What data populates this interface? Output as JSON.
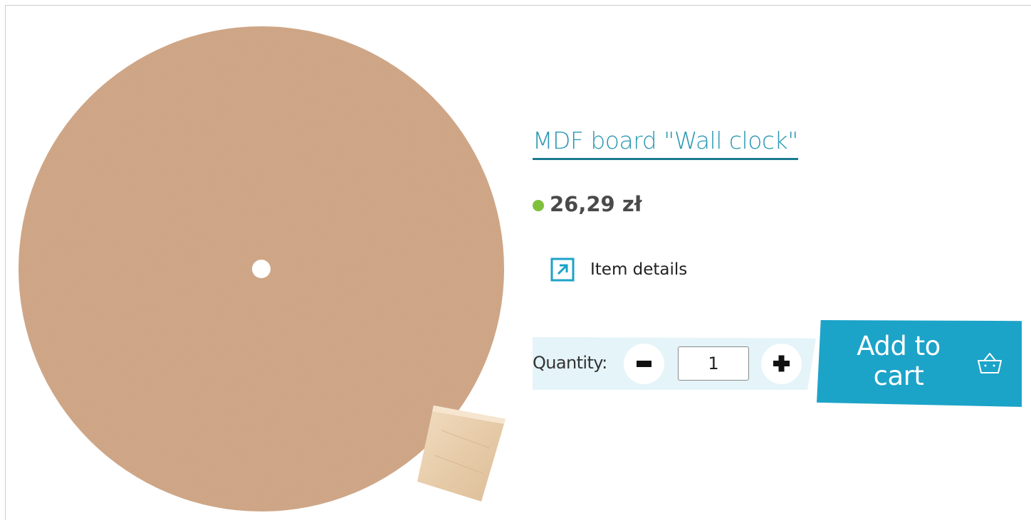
{
  "product": {
    "title": "MDF board \"Wall clock\"",
    "price": "26,29 zł",
    "details_label": "Item details",
    "quantity_label": "Quantity:",
    "quantity_value": "1",
    "add_to_cart_label": "Add to cart",
    "image_icon": "clock-board-photo"
  },
  "icons": {
    "stock": "stock-dot-icon",
    "details": "external-arrow-icon",
    "minus": "minus-icon",
    "plus": "plus-icon",
    "basket": "basket-icon"
  },
  "colors": {
    "accent": "#1ca3c8",
    "title_link": "#2a97b3",
    "title_underline": "#1c7a90",
    "stock_dot": "#7fc13b",
    "quantity_strip": "#e4f4f9",
    "price_text": "#4a4a4a"
  }
}
